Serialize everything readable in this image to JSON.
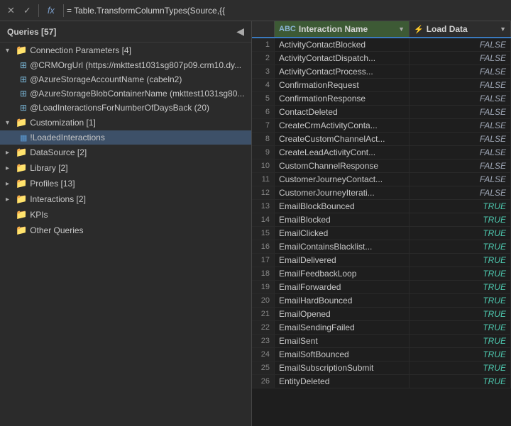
{
  "formulaBar": {
    "closeLabel": "✕",
    "checkLabel": "✓",
    "fxLabel": "fx",
    "formula": "= Table.TransformColumnTypes(Source,{{"
  },
  "queriesPanel": {
    "title": "Queries [57]",
    "collapseIcon": "◀",
    "groups": [
      {
        "id": "connection-params",
        "label": "Connection Parameters [4]",
        "expanded": true,
        "indent": 0,
        "type": "folder",
        "children": [
          {
            "id": "crm-org-url",
            "label": "@CRMOrgUrl (https://mkttest1031sg807p09.crm10.dy...",
            "indent": 1,
            "type": "param"
          },
          {
            "id": "azure-storage-account",
            "label": "@AzureStorageAccountName (cabeln2)",
            "indent": 1,
            "type": "param"
          },
          {
            "id": "azure-blob-container",
            "label": "@AzureStorageBlobContainerName (mkttest1031sg80...",
            "indent": 1,
            "type": "param"
          },
          {
            "id": "load-interactions",
            "label": "@LoadInteractionsForNumberOfDaysBack (20)",
            "indent": 1,
            "type": "param"
          }
        ]
      },
      {
        "id": "customization",
        "label": "Customization [1]",
        "expanded": true,
        "indent": 0,
        "type": "folder",
        "children": [
          {
            "id": "loaded-interactions",
            "label": "!LoadedInteractions",
            "indent": 1,
            "type": "table",
            "selected": true
          }
        ]
      },
      {
        "id": "datasource",
        "label": "DataSource [2]",
        "expanded": false,
        "indent": 0,
        "type": "folder",
        "children": []
      },
      {
        "id": "library",
        "label": "Library [2]",
        "expanded": false,
        "indent": 0,
        "type": "folder",
        "children": []
      },
      {
        "id": "profiles",
        "label": "Profiles [13]",
        "expanded": false,
        "indent": 0,
        "type": "folder",
        "children": []
      },
      {
        "id": "interactions",
        "label": "Interactions [2]",
        "expanded": false,
        "indent": 0,
        "type": "folder",
        "children": []
      },
      {
        "id": "kpis",
        "label": "KPIs",
        "expanded": false,
        "indent": 0,
        "type": "folder",
        "children": []
      },
      {
        "id": "other-queries",
        "label": "Other Queries",
        "expanded": false,
        "indent": 0,
        "type": "folder",
        "children": []
      }
    ]
  },
  "dataGrid": {
    "columns": [
      {
        "id": "num",
        "label": ""
      },
      {
        "id": "name",
        "label": "Interaction Name",
        "typeIcon": "ABC",
        "sortIcon": "▼"
      },
      {
        "id": "load",
        "label": "Load Data",
        "typeIcon": "⚡",
        "sortIcon": "▼"
      }
    ],
    "rows": [
      {
        "num": 1,
        "name": "ActivityContactBlocked",
        "load": "FALSE"
      },
      {
        "num": 2,
        "name": "ActivityContactDispatch...",
        "load": "FALSE"
      },
      {
        "num": 3,
        "name": "ActivityContactProcess...",
        "load": "FALSE"
      },
      {
        "num": 4,
        "name": "ConfirmationRequest",
        "load": "FALSE"
      },
      {
        "num": 5,
        "name": "ConfirmationResponse",
        "load": "FALSE"
      },
      {
        "num": 6,
        "name": "ContactDeleted",
        "load": "FALSE"
      },
      {
        "num": 7,
        "name": "CreateCrmActivityConta...",
        "load": "FALSE"
      },
      {
        "num": 8,
        "name": "CreateCustomChannelAct...",
        "load": "FALSE"
      },
      {
        "num": 9,
        "name": "CreateLeadActivityCont...",
        "load": "FALSE"
      },
      {
        "num": 10,
        "name": "CustomChannelResponse",
        "load": "FALSE"
      },
      {
        "num": 11,
        "name": "CustomerJourneyContact...",
        "load": "FALSE"
      },
      {
        "num": 12,
        "name": "CustomerJourneyIterati...",
        "load": "FALSE"
      },
      {
        "num": 13,
        "name": "EmailBlockBounced",
        "load": "TRUE"
      },
      {
        "num": 14,
        "name": "EmailBlocked",
        "load": "TRUE"
      },
      {
        "num": 15,
        "name": "EmailClicked",
        "load": "TRUE"
      },
      {
        "num": 16,
        "name": "EmailContainsBlacklist...",
        "load": "TRUE"
      },
      {
        "num": 17,
        "name": "EmailDelivered",
        "load": "TRUE"
      },
      {
        "num": 18,
        "name": "EmailFeedbackLoop",
        "load": "TRUE"
      },
      {
        "num": 19,
        "name": "EmailForwarded",
        "load": "TRUE"
      },
      {
        "num": 20,
        "name": "EmailHardBounced",
        "load": "TRUE"
      },
      {
        "num": 21,
        "name": "EmailOpened",
        "load": "TRUE"
      },
      {
        "num": 22,
        "name": "EmailSendingFailed",
        "load": "TRUE"
      },
      {
        "num": 23,
        "name": "EmailSent",
        "load": "TRUE"
      },
      {
        "num": 24,
        "name": "EmailSoftBounced",
        "load": "TRUE"
      },
      {
        "num": 25,
        "name": "EmailSubscriptionSubmit",
        "load": "TRUE"
      },
      {
        "num": 26,
        "name": "EntityDeleted",
        "load": "TRUE"
      }
    ]
  }
}
